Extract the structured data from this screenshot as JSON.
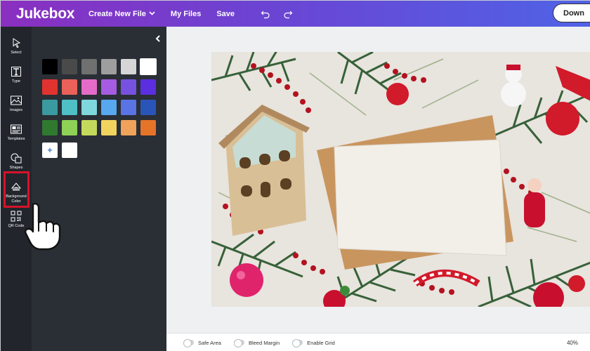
{
  "topbar": {
    "logo": "Jukebox",
    "nav": [
      {
        "label": "Create New File",
        "has_dropdown": true
      },
      {
        "label": "My Files"
      },
      {
        "label": "Save"
      }
    ],
    "undo_icon": "undo-icon",
    "redo_icon": "redo-icon",
    "download_label": "Down"
  },
  "rail": {
    "tools": [
      {
        "label": "Select",
        "icon": "cursor-icon"
      },
      {
        "label": "Type",
        "icon": "type-icon"
      },
      {
        "label": "Images",
        "icon": "image-icon"
      },
      {
        "label": "Templates",
        "icon": "templates-icon"
      },
      {
        "label": "Shapes",
        "icon": "shapes-icon"
      },
      {
        "label": "Background Color",
        "icon": "paint-bucket-icon",
        "highlighted": true
      },
      {
        "label": "QR Code",
        "icon": "qr-code-icon"
      }
    ]
  },
  "panel": {
    "collapse_icon": "chevron-left-icon",
    "swatches": [
      "#000000",
      "#4a4a4a",
      "#707070",
      "#9e9e9e",
      "#d6d6d6",
      "#ffffff",
      "#e0332f",
      "#e96158",
      "#e56bc8",
      "#a55ce0",
      "#7752e0",
      "#5b2ee0",
      "#3a9aa0",
      "#4ec0c6",
      "#7fd8dc",
      "#57a8ef",
      "#5a74e6",
      "#2a55b8",
      "#2f7a2f",
      "#8ed156",
      "#c2d95c",
      "#f2d35e",
      "#f0a15a",
      "#e57328"
    ],
    "selected_swatch_index": 5,
    "add_custom_label": "+",
    "custom_colors": [
      "#ffffff"
    ]
  },
  "canvas": {
    "photo_alt": "christmas-flatlay-photo"
  },
  "bottombar": {
    "toggles": [
      {
        "label": "Safe Area",
        "on": false
      },
      {
        "label": "Bleed Margin",
        "on": false
      },
      {
        "label": "Enable Grid",
        "on": false
      }
    ],
    "zoom": "40%"
  }
}
